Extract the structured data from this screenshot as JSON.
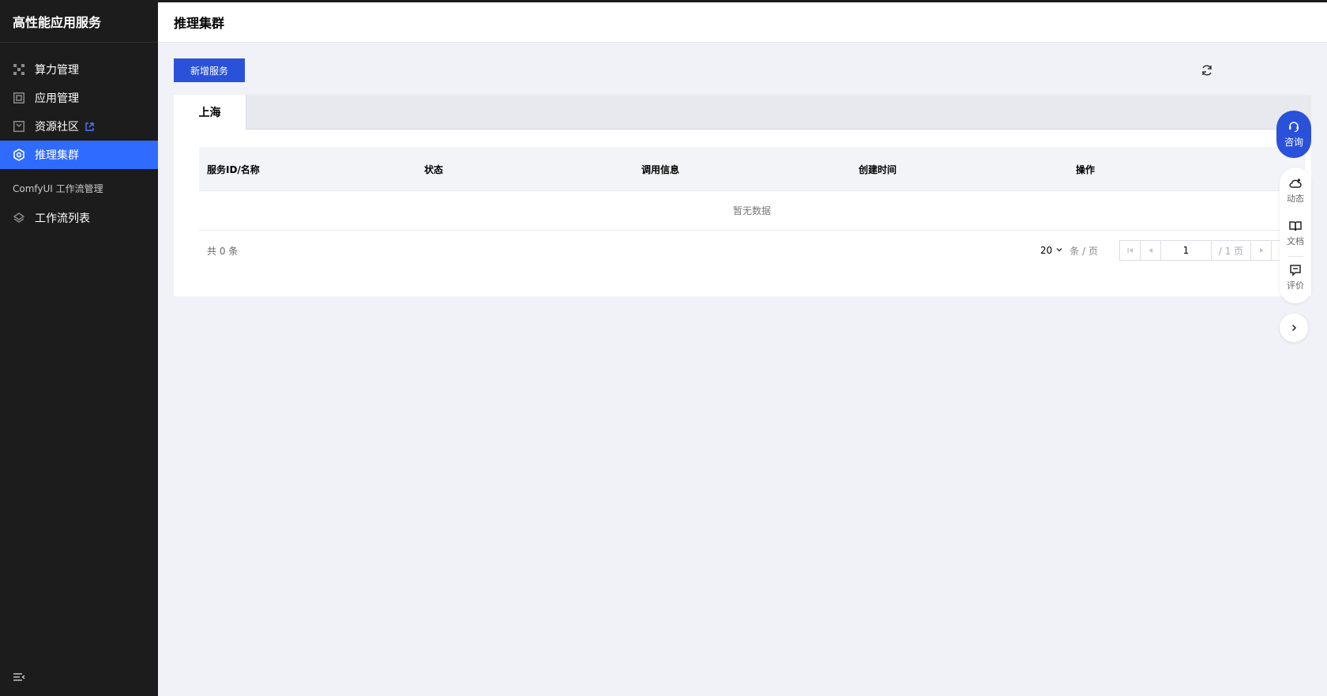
{
  "sidebar": {
    "brand": "高性能应用服务",
    "items": [
      {
        "label": "算力管理",
        "icon": "compute-icon"
      },
      {
        "label": "应用管理",
        "icon": "app-icon"
      },
      {
        "label": "资源社区",
        "icon": "store-icon"
      },
      {
        "label": "推理集群",
        "icon": "cluster-icon",
        "active": true
      }
    ],
    "group_title": "ComfyUI 工作流管理",
    "group_items": [
      {
        "label": "工作流列表",
        "icon": "layers-icon"
      }
    ]
  },
  "header": {
    "title": "推理集群"
  },
  "main": {
    "add_button": "新增服务",
    "tabs": [
      {
        "label": "上海",
        "active": true
      }
    ],
    "table": {
      "columns": [
        "服务ID/名称",
        "状态",
        "调用信息",
        "创建时间",
        "操作"
      ],
      "empty_text": "暂无数据"
    },
    "pagination": {
      "total_text": "共 0 条",
      "page_size": "20",
      "page_size_unit": "条 / 页",
      "current_page": "1",
      "total_pages": "/ 1 页"
    }
  },
  "float_tools": {
    "consult": "咨询",
    "dynamic": "动态",
    "docs": "文档",
    "review": "评价"
  },
  "colors": {
    "sidebar_bg": "#1c1c1c",
    "active_item": "#2f6bff",
    "primary_button": "#2a51d9",
    "page_bg": "#f1f2f7"
  }
}
